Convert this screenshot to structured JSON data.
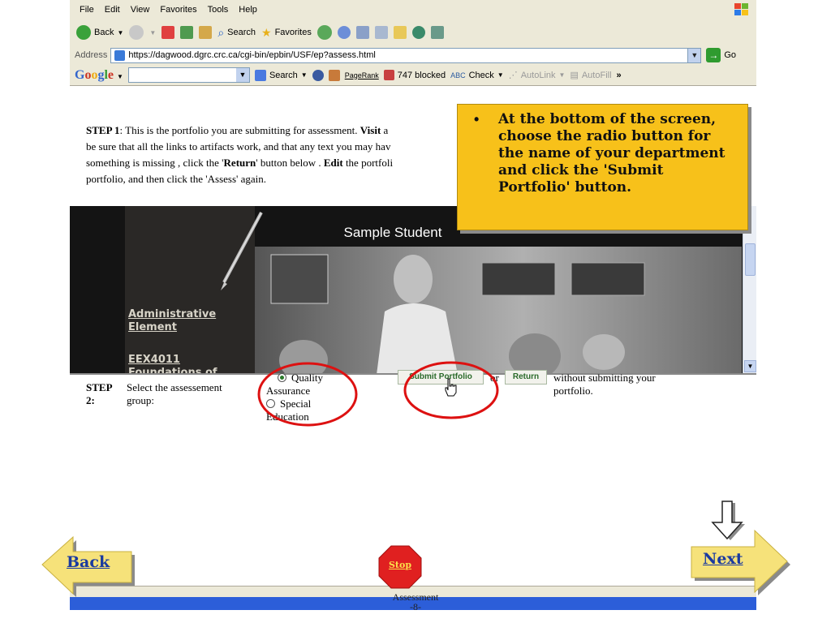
{
  "browser": {
    "menu": [
      "File",
      "Edit",
      "View",
      "Favorites",
      "Tools",
      "Help"
    ],
    "toolbar": {
      "back": "Back",
      "search": "Search",
      "favorites": "Favorites"
    },
    "address": {
      "label": "Address",
      "url": "https://dagwood.dgrc.crc.ca/cgi-bin/epbin/USF/ep?assess.html",
      "go": "Go"
    },
    "google_bar": {
      "logo": "Google",
      "search": "Search",
      "pagerank": "PageRank",
      "blocked": "747 blocked",
      "check": "Check",
      "autolink": "AutoLink",
      "autofill": "AutoFill",
      "more": "»"
    }
  },
  "page": {
    "step1": {
      "label": "STEP 1",
      "text_a": ": This is the portfolio you are submitting for assessment. ",
      "visit": "Visit",
      "text_b": " a",
      "line2": "be sure that all the links to artifacts work, and that any text you may hav",
      "line3a": "something is missing , click the '",
      "return": "Return",
      "line3b": "' button below . ",
      "edit": "Edit",
      "line3c": " the portfoli",
      "line4": "portfolio, and then click the 'Assess' again."
    },
    "frame": {
      "title": "Sample Student",
      "link1_l1": "Administrative",
      "link1_l2": "Element",
      "link2_l1": "EEX4011",
      "link2_l2": "Foundations of"
    },
    "step2": {
      "label_l1": "STEP",
      "label_l2": "2:",
      "prompt_l1": "Select the assessement",
      "prompt_l2": "group:",
      "option1_l1": "Quality",
      "option1_l2": "Assurance",
      "option2_l1": "Special",
      "option2_l2": "Education",
      "submit": "Submit Portfolio",
      "or": "or",
      "return": "Return",
      "tail_l1": "without submitting your",
      "tail_l2": "portfolio."
    }
  },
  "callout": {
    "bullet": "•",
    "text": "At the bottom of the screen, choose the radio button for the name of your department and click the 'Submit Portfolio' button."
  },
  "nav": {
    "back": "Back",
    "next": "Next",
    "stop": "Stop"
  },
  "footer": {
    "title": "Assessment",
    "page": "-8-"
  },
  "colors": {
    "callout": "#f7c11a",
    "nav_arrow": "#f6e27a",
    "stop": "#e02020",
    "highlight_circle": "#dd1111"
  }
}
